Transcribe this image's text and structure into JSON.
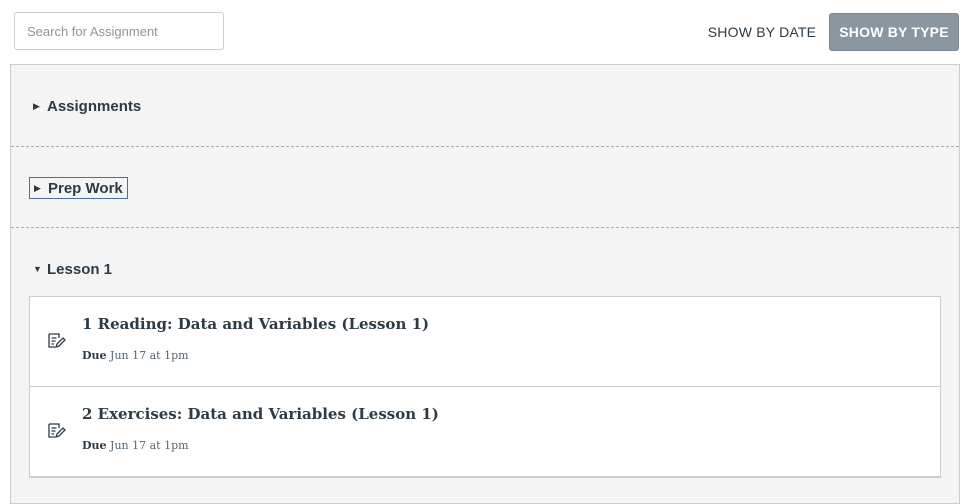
{
  "search": {
    "placeholder": "Search for Assignment"
  },
  "toolbar": {
    "show_by_date": "SHOW BY DATE",
    "show_by_type": "SHOW BY TYPE"
  },
  "groups": [
    {
      "title": "Assignments",
      "expanded": false
    },
    {
      "title": "Prep Work",
      "expanded": false,
      "focused": true
    },
    {
      "title": "Lesson 1",
      "expanded": true,
      "items": [
        {
          "icon": "assignment-icon",
          "title": "1 Reading: Data and Variables (Lesson 1)",
          "due_label": "Due",
          "due_date": "Jun 17 at 1pm"
        },
        {
          "icon": "assignment-icon",
          "title": "2 Exercises: Data and Variables (Lesson 1)",
          "due_label": "Due",
          "due_date": "Jun 17 at 1pm"
        }
      ]
    }
  ],
  "colors": {
    "active_button": "#8b969e",
    "group_bg": "#f4f4f4",
    "text": "#2d3b45"
  }
}
